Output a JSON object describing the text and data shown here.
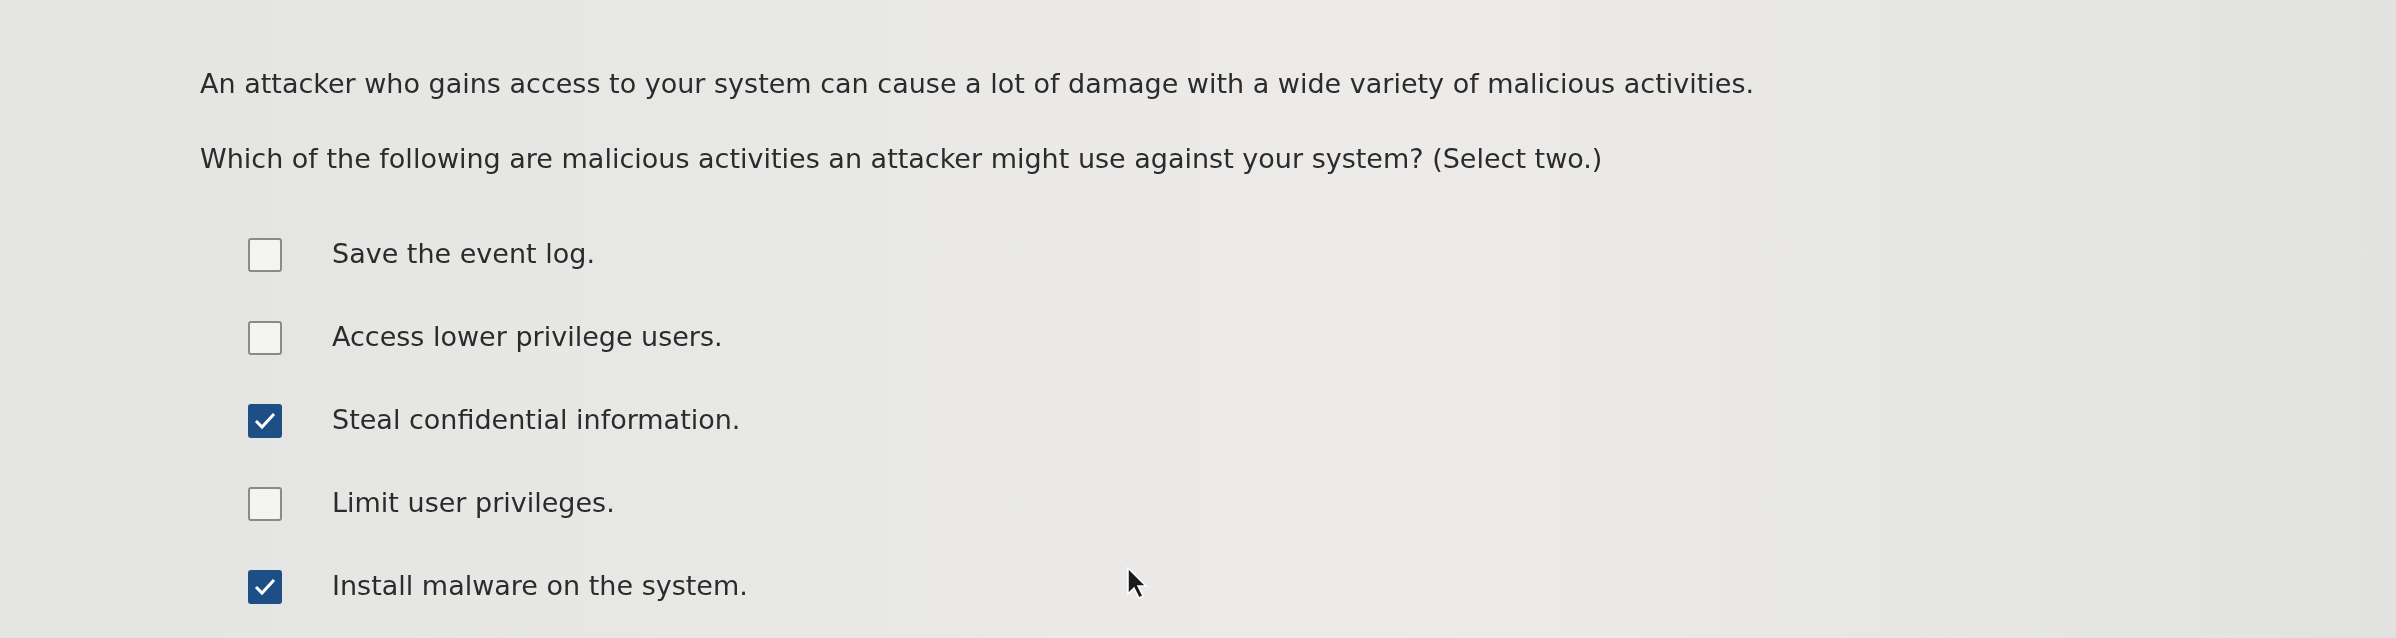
{
  "intro": "An attacker who gains access to your system can cause a lot of damage with a wide variety of malicious activities.",
  "question": "Which of the following are malicious activities an attacker might use against your system? (Select two.)",
  "options": [
    {
      "label": "Save the event log.",
      "checked": false
    },
    {
      "label": "Access lower privilege users.",
      "checked": false
    },
    {
      "label": "Steal confidential information.",
      "checked": true
    },
    {
      "label": "Limit user privileges.",
      "checked": false
    },
    {
      "label": "Install malware on the system.",
      "checked": true
    }
  ]
}
